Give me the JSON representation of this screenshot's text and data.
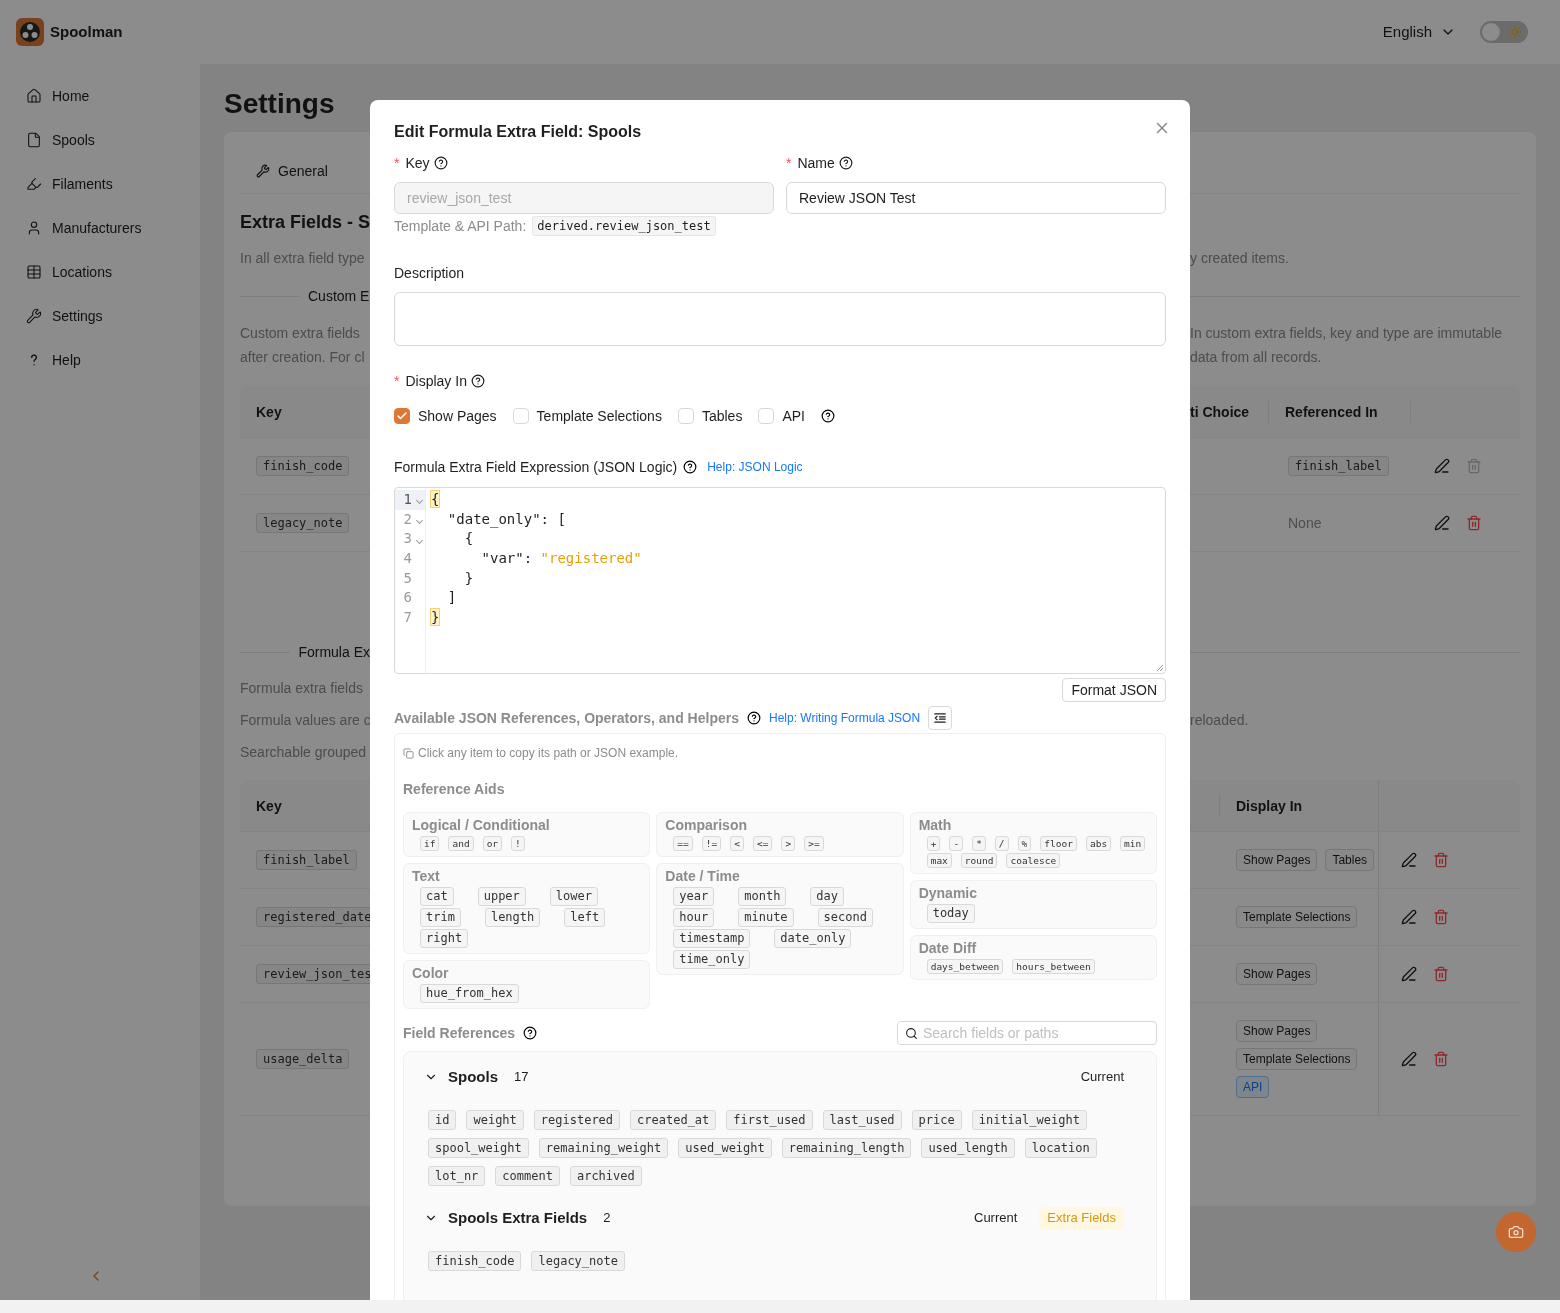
{
  "app": {
    "name": "Spoolman"
  },
  "header": {
    "language": "English",
    "theme_toggle": {
      "on": false
    }
  },
  "sidebar": {
    "items": [
      {
        "label": "Home"
      },
      {
        "label": "Spools"
      },
      {
        "label": "Filaments"
      },
      {
        "label": "Manufacturers"
      },
      {
        "label": "Locations"
      },
      {
        "label": "Settings"
      },
      {
        "label": "Help"
      }
    ]
  },
  "settings": {
    "title": "Settings",
    "tabs": [
      {
        "label": "General",
        "selected": false
      }
    ],
    "heading": "Extra Fields - S",
    "intro": {
      "left": "In all extra field type",
      "right": "y created items."
    },
    "custom_section": {
      "divider_label": "Custom E",
      "notes": [
        {
          "left": "Custom extra fields",
          "right": "In custom extra fields, key and type are immutable"
        },
        {
          "left": "after creation. For cl",
          "right": "data from all records."
        }
      ],
      "table": {
        "columns": [
          "Key",
          "ti Choice",
          "Referenced In"
        ],
        "rows": [
          {
            "key": "finish_code",
            "referenced_in": {
              "kind": "chips",
              "items": [
                "finish_label"
              ]
            },
            "delete_disabled": true
          },
          {
            "key": "legacy_note",
            "referenced_in": {
              "kind": "text",
              "text": "None"
            },
            "delete_disabled": false
          }
        ]
      }
    },
    "formula_section": {
      "divider_label": "Formula Ex",
      "notes": [
        {
          "left": "Formula extra fields"
        },
        {
          "left": "Formula values are c",
          "right": "reloaded."
        },
        {
          "left": "Searchable grouped"
        }
      ],
      "table": {
        "columns": [
          "Key",
          "Display In"
        ],
        "rows": [
          {
            "key": "finish_label",
            "display_in": [
              {
                "label": "Show Pages",
                "kind": "plain"
              },
              {
                "label": "Tables",
                "kind": "plain"
              }
            ]
          },
          {
            "key": "registered_date",
            "display_in": [
              {
                "label": "Template Selections",
                "kind": "plain"
              }
            ]
          },
          {
            "key": "review_json_tes",
            "display_in": [
              {
                "label": "Show Pages",
                "kind": "plain"
              }
            ]
          },
          {
            "key": "usage_delta",
            "display_in": [
              {
                "label": "Show Pages",
                "kind": "plain"
              },
              {
                "label": "Template Selections",
                "kind": "plain"
              },
              {
                "label": "API",
                "kind": "api"
              }
            ]
          }
        ]
      }
    }
  },
  "dialog": {
    "title": "Edit Formula Extra Field: Spools",
    "key_field": {
      "label": "Key",
      "required_mark": "*",
      "value": "review_json_test",
      "disabled": true
    },
    "path": {
      "label": "Template & API Path:",
      "value": "derived.review_json_test"
    },
    "name_field": {
      "label": "Name",
      "required_mark": "*",
      "value": "Review JSON Test",
      "disabled": false
    },
    "description_field": {
      "label": "Description"
    },
    "display_in": {
      "label": "Display In",
      "required_mark": "*",
      "options": [
        {
          "label": "Show Pages",
          "checked": true
        },
        {
          "label": "Template Selections",
          "checked": false
        },
        {
          "label": "Tables",
          "checked": false
        },
        {
          "label": "API",
          "checked": false
        }
      ]
    },
    "expression": {
      "label": "Formula Extra Field Expression (JSON Logic)",
      "help_link": "Help: JSON Logic",
      "lines": [
        {
          "number": "1",
          "active": true,
          "foldable": true,
          "tokens": [
            {
              "text": "{",
              "kind": "matched"
            }
          ]
        },
        {
          "number": "2",
          "active": false,
          "foldable": true,
          "tokens": [
            {
              "text": "  \"date_only\": [",
              "kind": "plain"
            }
          ]
        },
        {
          "number": "3",
          "active": false,
          "foldable": true,
          "tokens": [
            {
              "text": "    {",
              "kind": "plain"
            }
          ]
        },
        {
          "number": "4",
          "active": false,
          "foldable": false,
          "tokens": [
            {
              "text": "      \"var\": ",
              "kind": "plain"
            },
            {
              "text": "\"registered\"",
              "kind": "string"
            }
          ]
        },
        {
          "number": "5",
          "active": false,
          "foldable": false,
          "tokens": [
            {
              "text": "    }",
              "kind": "plain"
            }
          ]
        },
        {
          "number": "6",
          "active": false,
          "foldable": false,
          "tokens": [
            {
              "text": "  ]",
              "kind": "plain"
            }
          ]
        },
        {
          "number": "7",
          "active": false,
          "foldable": false,
          "tokens": [
            {
              "text": "}",
              "kind": "matched"
            }
          ]
        }
      ]
    },
    "format_button": "Format JSON",
    "references": {
      "label": "Available JSON References, Operators, and Helpers",
      "help_link": "Help: Writing Formula JSON",
      "hint": "Click any item to copy its path or JSON example.",
      "aids_label": "Reference Aids",
      "columns": [
        [
          {
            "title": "Logical / Conditional",
            "items": [
              "if",
              "and",
              "or",
              "!"
            ]
          },
          {
            "title": "Text",
            "items": [
              "cat",
              "upper",
              "lower",
              "trim",
              "length",
              "left",
              "right"
            ]
          },
          {
            "title": "Color",
            "items": [
              "hue_from_hex"
            ]
          }
        ],
        [
          {
            "title": "Comparison",
            "items": [
              "==",
              "!=",
              "<",
              "<=",
              ">",
              ">="
            ]
          },
          {
            "title": "Date / Time",
            "items": [
              "year",
              "month",
              "day",
              "hour",
              "minute",
              "second",
              "timestamp",
              "date_only",
              "time_only"
            ]
          }
        ],
        [
          {
            "title": "Math",
            "items": [
              "+",
              "-",
              "*",
              "/",
              "%",
              "floor",
              "abs",
              "min",
              "max",
              "round",
              "coalesce"
            ]
          },
          {
            "title": "Dynamic",
            "items": [
              "today"
            ]
          },
          {
            "title": "Date Diff",
            "items": [
              "days_between",
              "hours_between"
            ]
          }
        ]
      ]
    },
    "field_references": {
      "label": "Field References",
      "search_placeholder": "Search fields or paths",
      "groups": [
        {
          "title": "Spools",
          "count": "17",
          "expanded": true,
          "scope": "Current",
          "fields": [
            "id",
            "weight",
            "registered",
            "created_at",
            "first_used",
            "last_used",
            "price",
            "initial_weight",
            "spool_weight",
            "remaining_weight",
            "used_weight",
            "remaining_length",
            "used_length",
            "location",
            "lot_nr",
            "comment",
            "archived"
          ]
        },
        {
          "title": "Spools Extra Fields",
          "count": "2",
          "expanded": true,
          "scope": "Current",
          "badge": "Extra Fields",
          "fields": [
            "finish_code",
            "legacy_note"
          ]
        }
      ]
    }
  }
}
